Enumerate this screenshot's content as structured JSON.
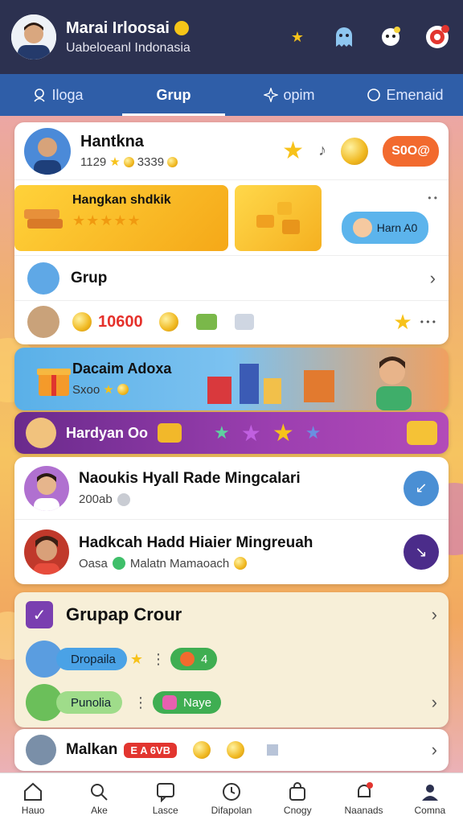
{
  "header": {
    "name": "Marai Irloosai",
    "subtitle": "Uabeloeanl Indonasia"
  },
  "tabs": [
    {
      "label": "Iloga"
    },
    {
      "label": "Grup"
    },
    {
      "label": "opim"
    },
    {
      "label": "Emenaid"
    }
  ],
  "profile_card": {
    "name": "Hantkna",
    "stats_a": "1129",
    "stats_b": "3339",
    "chip_label": "S0O@",
    "chip_color": "#f26a2e",
    "banner_title": "Hangkan shdkik",
    "banner_side_label": "Harn A0",
    "group_row_label": "Grup",
    "reward_amount": "10600",
    "more_dots": "• • •"
  },
  "promo_banner": {
    "title": "Dacaim Adoxa",
    "subtitle": "Sxoo"
  },
  "purple_strip": {
    "label": "Hardyan Oo"
  },
  "members": [
    {
      "name": "Naoukis Hyall Rade Mingcalari",
      "detail": "200ab",
      "button_color": "#4a8fd4"
    },
    {
      "name": "Hadkcah Hadd Hiaier Mingreuah",
      "detail_a": "Oasa",
      "detail_b": "Malatn Mamaoach",
      "button_color": "#4b2c8a"
    }
  ],
  "group_panel": {
    "title": "Grupap Crour",
    "rows": [
      {
        "pill": "Dropaila",
        "badge": "4"
      },
      {
        "pill": "Punolia",
        "badge": "Naye"
      }
    ]
  },
  "last_row": {
    "name": "Malkan",
    "tag": "E A 6VB"
  },
  "bottom_nav": [
    {
      "label": "Hauo",
      "icon": "home-icon"
    },
    {
      "label": "Ake",
      "icon": "search-icon"
    },
    {
      "label": "Lasce",
      "icon": "chat-icon"
    },
    {
      "label": "Difapolan",
      "icon": "clock-icon"
    },
    {
      "label": "Cnogy",
      "icon": "bag-icon"
    },
    {
      "label": "Naanads",
      "icon": "bell-icon"
    },
    {
      "label": "Comna",
      "icon": "person-icon"
    }
  ]
}
